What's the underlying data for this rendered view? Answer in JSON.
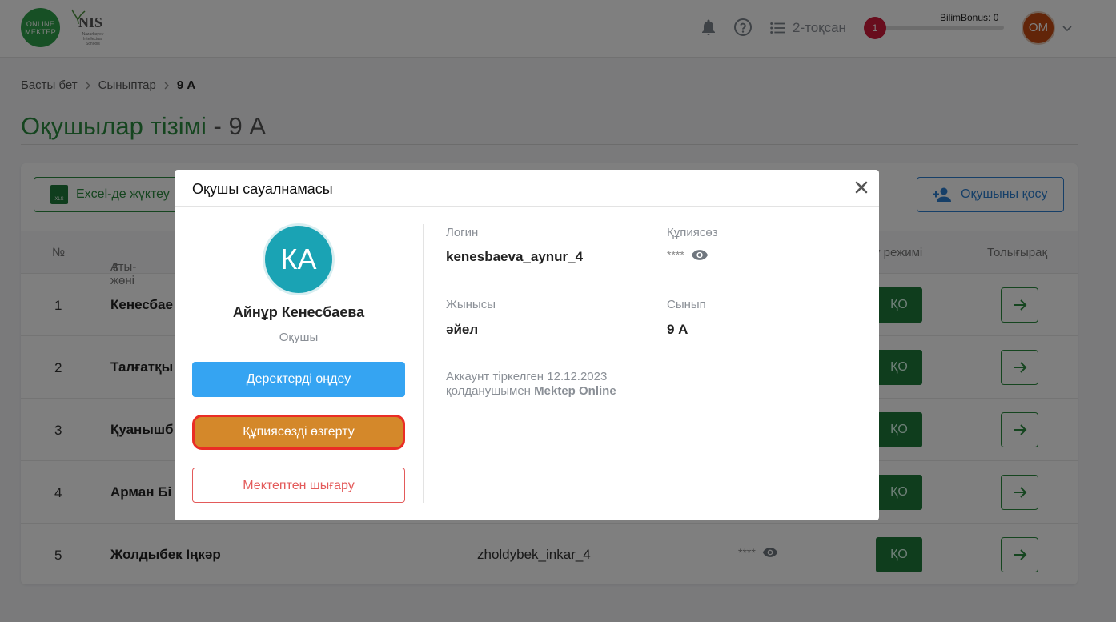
{
  "header": {
    "logo_text": "ONLINE MEKTEP",
    "nis_text": "NIS",
    "nis_sub": "Nazarbayev Intellectual Schools",
    "quarter_label": "2-тоқсан",
    "bonus_label": "BilimBonus: 0",
    "bonus_badge": "1",
    "bonus_progress": 0,
    "avatar_initials": "ОМ"
  },
  "breadcrumb": {
    "home": "Басты бет",
    "classes": "Сыныптар",
    "current": "9 А"
  },
  "page": {
    "title": "Оқушылар тізімі",
    "title_sep": " - ",
    "class_name": "9 А"
  },
  "toolbar": {
    "excel_label": "Excel-де жүктеу",
    "add_student_label": "Оқушыны қосу"
  },
  "table": {
    "headers": {
      "num": "№",
      "name": "Аты-жөні",
      "mode": "у режимі",
      "more": "Толығырақ"
    },
    "rows": [
      {
        "num": "1",
        "name": "Кенесбае",
        "login": "",
        "password": "",
        "mode": "ҚО"
      },
      {
        "num": "2",
        "name": "Талғатқы",
        "login": "",
        "password": "",
        "mode": "ҚО"
      },
      {
        "num": "3",
        "name": "Қуанышб",
        "login": "",
        "password": "",
        "mode": "ҚО"
      },
      {
        "num": "4",
        "name": "Арман Бі",
        "login": "",
        "password": "",
        "mode": "ҚО"
      },
      {
        "num": "5",
        "name": "Жолдыбек Іңкәр",
        "login": "zholdybek_inkar_4",
        "password": "****",
        "mode": "ҚО"
      }
    ]
  },
  "modal": {
    "title": "Оқушы сауалнамасы",
    "avatar_initials": "КА",
    "student_name": "Айнұр Кенесбаева",
    "role": "Оқушы",
    "edit_button": "Деректерді өңдеу",
    "change_password_button": "Құпиясөзді өзгерту",
    "expel_button": "Мектептен шығару",
    "fields": {
      "login_label": "Логин",
      "login_value": "kenesbaeva_aynur_4",
      "password_label": "Құпиясөз",
      "password_value": "****",
      "gender_label": "Жынысы",
      "gender_value": "әйел",
      "class_label": "Сынып",
      "class_value": "9 А"
    },
    "registered_text": "Аккаунт тіркелген 12.12.2023 қолданушымен",
    "registered_by": "Mektep Online"
  },
  "colors": {
    "brand_green": "#2a8a3e",
    "primary_blue": "#35a4f2",
    "warning_orange": "#d4882a",
    "highlight_red": "#ea2d25",
    "danger_red": "#e35a5a"
  }
}
